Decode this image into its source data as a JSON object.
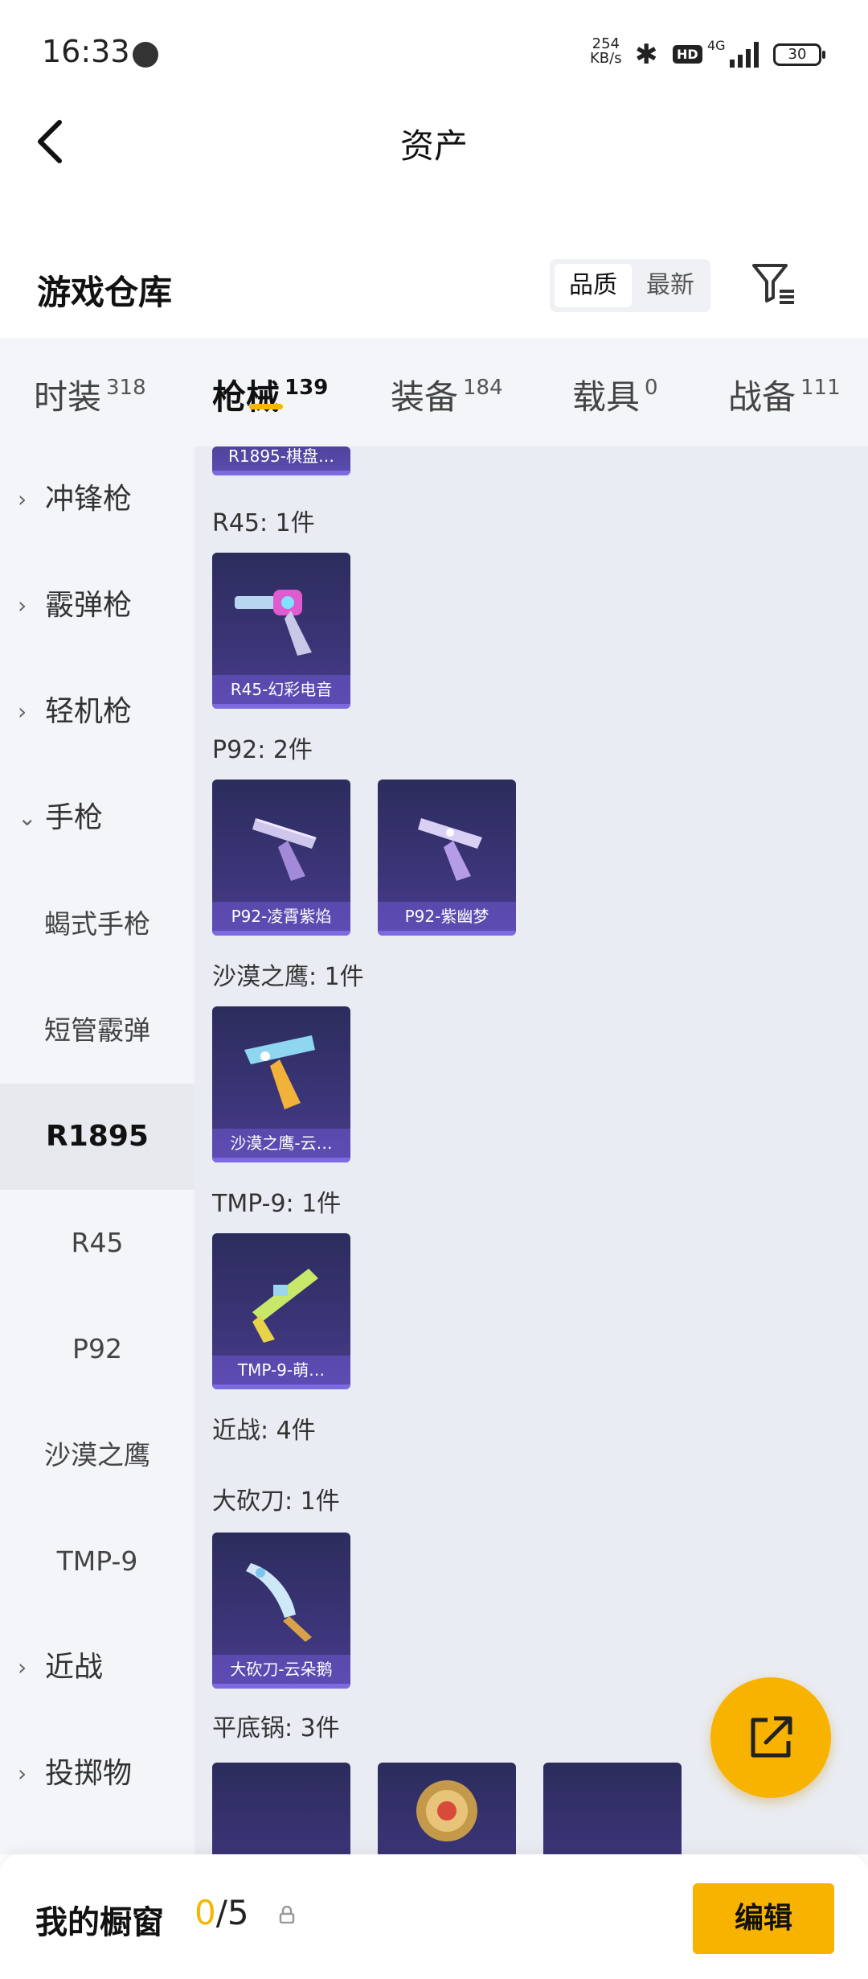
{
  "status_bar": {
    "time": "16:33",
    "speed_value": "254",
    "speed_unit": "KB/s",
    "hd": "HD",
    "network": "4G",
    "battery": "30"
  },
  "header": {
    "title": "资产"
  },
  "warehouse": {
    "title": "游戏仓库",
    "sort_quality": "品质",
    "sort_newest": "最新"
  },
  "tabs": [
    {
      "label": "时装",
      "count": "318"
    },
    {
      "label": "枪械",
      "count": "139"
    },
    {
      "label": "装备",
      "count": "184"
    },
    {
      "label": "载具",
      "count": "0"
    },
    {
      "label": "战备",
      "count": "111"
    }
  ],
  "sidebar": {
    "items": [
      {
        "label": "冲锋枪",
        "chevron": "›"
      },
      {
        "label": "霰弹枪",
        "chevron": "›"
      },
      {
        "label": "轻机枪",
        "chevron": "›"
      },
      {
        "label": "手枪",
        "chevron": "⌄"
      },
      {
        "label": "蝎式手枪"
      },
      {
        "label": "短管霰弹"
      },
      {
        "label": "R1895"
      },
      {
        "label": "R45"
      },
      {
        "label": "P92"
      },
      {
        "label": "沙漠之鹰"
      },
      {
        "label": "TMP-9"
      },
      {
        "label": "近战",
        "chevron": "›"
      },
      {
        "label": "投掷物",
        "chevron": "›"
      }
    ]
  },
  "content": {
    "partial_card": "R1895-棋盘…",
    "groups": [
      {
        "title": "R45: 1件",
        "items": [
          "R45-幻彩电音"
        ]
      },
      {
        "title": "P92: 2件",
        "items": [
          "P92-凌霄紫焰",
          "P92-紫幽梦"
        ]
      },
      {
        "title": "沙漠之鹰: 1件",
        "items": [
          "沙漠之鹰-云…"
        ]
      },
      {
        "title": "TMP-9: 1件",
        "items": [
          "TMP-9-萌…"
        ]
      },
      {
        "title": "近战: 4件",
        "items": []
      },
      {
        "title": "大砍刀: 1件",
        "items": [
          "大砍刀-云朵鹅"
        ]
      },
      {
        "title": "平底锅: 3件",
        "items": [
          "",
          "",
          ""
        ]
      }
    ]
  },
  "bottom_bar": {
    "title": "我的橱窗",
    "count_current": "0",
    "count_total": "/5",
    "edit": "编辑"
  },
  "colors": {
    "accent": "#f8b300",
    "card_bg": "#3b3578",
    "card_label": "#6e5ad2"
  }
}
